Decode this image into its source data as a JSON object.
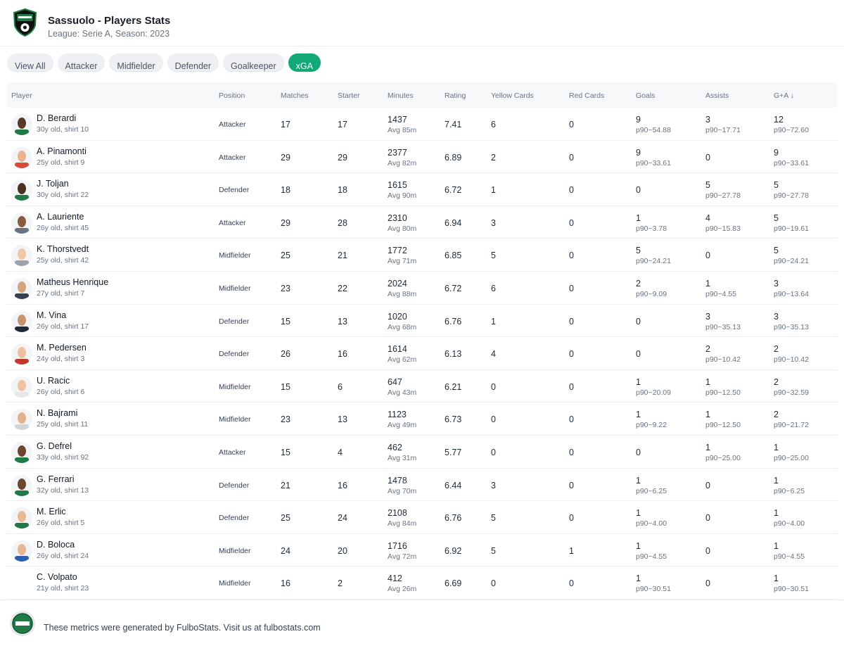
{
  "header": {
    "title": "Sassuolo - Players Stats",
    "subtitle": "League: Serie A, Season: 2023"
  },
  "tabs": [
    "View All",
    "Attacker",
    "Midfielder",
    "Defender",
    "Goalkeeper",
    "xGA"
  ],
  "active_tab": "xGA",
  "columns": {
    "player": "Player",
    "position": "Position",
    "matches": "Matches",
    "starter": "Starter",
    "minutes": "Minutes",
    "rating": "Rating",
    "yellow": "Yellow Cards",
    "red": "Red Cards",
    "goals": "Goals",
    "assists": "Assists",
    "ga": "G+A ↓"
  },
  "players": [
    {
      "name": "D. Berardi",
      "meta": "30y old, shirt 10",
      "position": "Attacker",
      "matches": "17",
      "starter": "17",
      "minutes": "1437",
      "avg": "Avg 85m",
      "rating": "7.41",
      "yellow": "6",
      "red": "0",
      "goals": "9",
      "goals_p90": "p90~54.88",
      "assists": "3",
      "assists_p90": "p90~17.71",
      "ga": "12",
      "ga_p90": "p90~72.60",
      "skin": "#5a3a26",
      "shirt": "#1f7a45"
    },
    {
      "name": "A. Pinamonti",
      "meta": "25y old, shirt 9",
      "position": "Attacker",
      "matches": "29",
      "starter": "29",
      "minutes": "2377",
      "avg": "Avg 82m",
      "rating": "6.89",
      "yellow": "2",
      "red": "0",
      "goals": "9",
      "goals_p90": "p90~33.61",
      "assists": "0",
      "assists_p90": "",
      "ga": "9",
      "ga_p90": "p90~33.61",
      "skin": "#e9b48f",
      "shirt": "#d94c3a"
    },
    {
      "name": "J. Toljan",
      "meta": "30y old, shirt 22",
      "position": "Defender",
      "matches": "18",
      "starter": "18",
      "minutes": "1615",
      "avg": "Avg 90m",
      "rating": "6.72",
      "yellow": "1",
      "red": "0",
      "goals": "0",
      "goals_p90": "",
      "assists": "5",
      "assists_p90": "p90~27.78",
      "ga": "5",
      "ga_p90": "p90~27.78",
      "skin": "#4a3020",
      "shirt": "#1f7a45"
    },
    {
      "name": "A. Lauriente",
      "meta": "26y old, shirt 45",
      "position": "Attacker",
      "matches": "29",
      "starter": "28",
      "minutes": "2310",
      "avg": "Avg 80m",
      "rating": "6.94",
      "yellow": "3",
      "red": "0",
      "goals": "1",
      "goals_p90": "p90~3.78",
      "assists": "4",
      "assists_p90": "p90~15.83",
      "ga": "5",
      "ga_p90": "p90~19.61",
      "skin": "#8a5a40",
      "shirt": "#6b7280"
    },
    {
      "name": "K. Thorstvedt",
      "meta": "25y old, shirt 42",
      "position": "Midfielder",
      "matches": "25",
      "starter": "21",
      "minutes": "1772",
      "avg": "Avg 71m",
      "rating": "6.85",
      "yellow": "5",
      "red": "0",
      "goals": "5",
      "goals_p90": "p90~24.21",
      "assists": "0",
      "assists_p90": "",
      "ga": "5",
      "ga_p90": "p90~24.21",
      "skin": "#efc6a8",
      "shirt": "#9ca3af"
    },
    {
      "name": "Matheus Henrique",
      "meta": "27y old, shirt 7",
      "position": "Midfielder",
      "matches": "23",
      "starter": "22",
      "minutes": "2024",
      "avg": "Avg 88m",
      "rating": "6.72",
      "yellow": "6",
      "red": "0",
      "goals": "2",
      "goals_p90": "p90~9.09",
      "assists": "1",
      "assists_p90": "p90~4.55",
      "ga": "3",
      "ga_p90": "p90~13.64",
      "skin": "#d6a27e",
      "shirt": "#374151"
    },
    {
      "name": "M. Vina",
      "meta": "26y old, shirt 17",
      "position": "Defender",
      "matches": "15",
      "starter": "13",
      "minutes": "1020",
      "avg": "Avg 68m",
      "rating": "6.76",
      "yellow": "1",
      "red": "0",
      "goals": "0",
      "goals_p90": "",
      "assists": "3",
      "assists_p90": "p90~35.13",
      "ga": "3",
      "ga_p90": "p90~35.13",
      "skin": "#c9936f",
      "shirt": "#1f2937"
    },
    {
      "name": "M. Pedersen",
      "meta": "24y old, shirt 3",
      "position": "Defender",
      "matches": "26",
      "starter": "16",
      "minutes": "1614",
      "avg": "Avg 62m",
      "rating": "6.13",
      "yellow": "4",
      "red": "0",
      "goals": "0",
      "goals_p90": "",
      "assists": "2",
      "assists_p90": "p90~10.42",
      "ga": "2",
      "ga_p90": "p90~10.42",
      "skin": "#eec0a0",
      "shirt": "#c0392b"
    },
    {
      "name": "U. Racic",
      "meta": "26y old, shirt 6",
      "position": "Midfielder",
      "matches": "15",
      "starter": "6",
      "minutes": "647",
      "avg": "Avg 43m",
      "rating": "6.21",
      "yellow": "0",
      "red": "0",
      "goals": "1",
      "goals_p90": "p90~20.09",
      "assists": "1",
      "assists_p90": "p90~12.50",
      "ga": "2",
      "ga_p90": "p90~32.59",
      "skin": "#efc2a2",
      "shirt": "#e5e7eb"
    },
    {
      "name": "N. Bajrami",
      "meta": "25y old, shirt 11",
      "position": "Midfielder",
      "matches": "23",
      "starter": "13",
      "minutes": "1123",
      "avg": "Avg 49m",
      "rating": "6.73",
      "yellow": "0",
      "red": "0",
      "goals": "1",
      "goals_p90": "p90~9.22",
      "assists": "1",
      "assists_p90": "p90~12.50",
      "ga": "2",
      "ga_p90": "p90~21.72",
      "skin": "#e3b08c",
      "shirt": "#d1d5db"
    },
    {
      "name": "G. Defrel",
      "meta": "33y old, shirt 92",
      "position": "Attacker",
      "matches": "15",
      "starter": "4",
      "minutes": "462",
      "avg": "Avg 31m",
      "rating": "5.77",
      "yellow": "0",
      "red": "0",
      "goals": "0",
      "goals_p90": "",
      "assists": "1",
      "assists_p90": "p90~25.00",
      "ga": "1",
      "ga_p90": "p90~25.00",
      "skin": "#6b4630",
      "shirt": "#1f7a45"
    },
    {
      "name": "G. Ferrari",
      "meta": "32y old, shirt 13",
      "position": "Defender",
      "matches": "21",
      "starter": "16",
      "minutes": "1478",
      "avg": "Avg 70m",
      "rating": "6.44",
      "yellow": "3",
      "red": "0",
      "goals": "1",
      "goals_p90": "p90~6.25",
      "assists": "0",
      "assists_p90": "",
      "ga": "1",
      "ga_p90": "p90~6.25",
      "skin": "#6b4630",
      "shirt": "#1f7a45"
    },
    {
      "name": "M. Erlic",
      "meta": "26y old, shirt 5",
      "position": "Defender",
      "matches": "25",
      "starter": "24",
      "minutes": "2108",
      "avg": "Avg 84m",
      "rating": "6.76",
      "yellow": "5",
      "red": "0",
      "goals": "1",
      "goals_p90": "p90~4.00",
      "assists": "0",
      "assists_p90": "",
      "ga": "1",
      "ga_p90": "p90~4.00",
      "skin": "#e7b994",
      "shirt": "#1f7a45"
    },
    {
      "name": "D. Boloca",
      "meta": "26y old, shirt 24",
      "position": "Midfielder",
      "matches": "24",
      "starter": "20",
      "minutes": "1716",
      "avg": "Avg 72m",
      "rating": "6.92",
      "yellow": "5",
      "red": "1",
      "goals": "1",
      "goals_p90": "p90~4.55",
      "assists": "0",
      "assists_p90": "",
      "ga": "1",
      "ga_p90": "p90~4.55",
      "skin": "#e8b692",
      "shirt": "#2f5fb3"
    },
    {
      "name": "C. Volpato",
      "meta": "21y old, shirt 23",
      "position": "Midfielder",
      "matches": "16",
      "starter": "2",
      "minutes": "412",
      "avg": "Avg 26m",
      "rating": "6.69",
      "yellow": "0",
      "red": "0",
      "goals": "1",
      "goals_p90": "p90~30.51",
      "assists": "0",
      "assists_p90": "",
      "ga": "1",
      "ga_p90": "p90~30.51",
      "skin": "",
      "shirt": ""
    }
  ],
  "footer": {
    "text": "These metrics were generated by FulboStats. Visit us at fulbostats.com"
  },
  "colors": {
    "accent": "#13a877",
    "club_green": "#1f7a45"
  }
}
